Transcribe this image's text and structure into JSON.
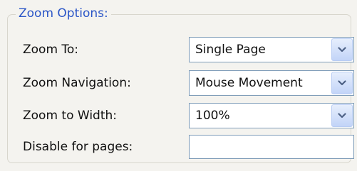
{
  "zoom_options": {
    "title": "Zoom Options:",
    "zoom_to": {
      "label": "Zoom To:",
      "value": "Single Page"
    },
    "zoom_navigation": {
      "label": "Zoom Navigation:",
      "value": "Mouse Movement"
    },
    "zoom_to_width": {
      "label": "Zoom to Width:",
      "value": "100%"
    },
    "disable_for_pages": {
      "label": "Disable for pages:",
      "value": ""
    }
  },
  "icons": {
    "dropdown": "chevron-down-icon"
  },
  "colors": {
    "title": "#2a55c7",
    "background": "#f4f3ef",
    "field_border": "#7f9db9",
    "dropdown_arrow": "#4d6185"
  }
}
